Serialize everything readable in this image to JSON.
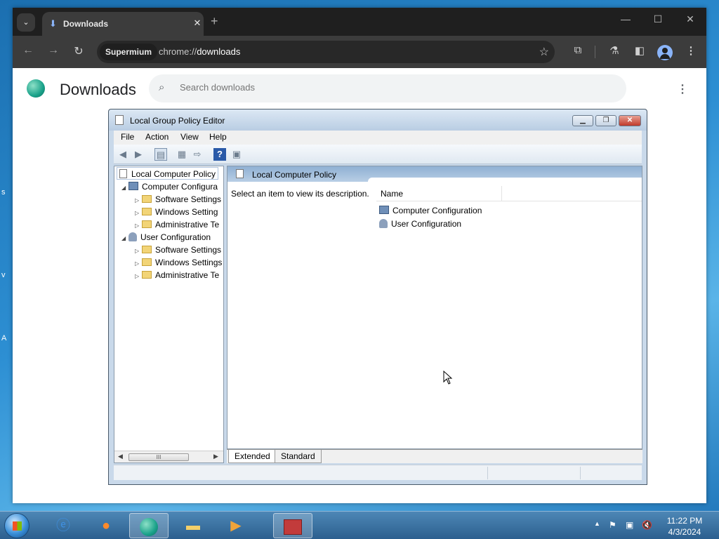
{
  "browser": {
    "tab_title": "Downloads",
    "tab_close": "✕",
    "new_tab": "+",
    "window_controls": {
      "minimize": "—",
      "maximize": "☐",
      "close": "✕"
    },
    "profile_chip": "Supermium",
    "url_scheme": "chrome://",
    "url_host": "downloads",
    "icons": {
      "back": "back-arrow-icon",
      "forward": "forward-arrow-icon",
      "reload": "reload-icon",
      "star": "bookmark-star-icon"
    }
  },
  "downloads_page": {
    "title": "Downloads",
    "search_placeholder": "Search downloads",
    "menu": "⋮"
  },
  "gpe": {
    "title": "Local Group Policy Editor",
    "menu": [
      "File",
      "Action",
      "View",
      "Help"
    ],
    "tree": {
      "root": "Local Computer Policy",
      "computer_config": "Computer Configura",
      "computer_children": [
        "Software Settings",
        "Windows Setting",
        "Administrative Te"
      ],
      "user_config": "User Configuration",
      "user_children": [
        "Software Settings",
        "Windows Settings",
        "Administrative Te"
      ]
    },
    "right_header": "Local Computer Policy",
    "description": "Select an item to view its description.",
    "column_name": "Name",
    "list": [
      "Computer Configuration",
      "User Configuration"
    ],
    "tabs": [
      "Extended",
      "Standard"
    ],
    "scroll_thumb": "III"
  },
  "taskbar": {
    "time": "11:22 PM",
    "date": "4/3/2024",
    "apps": [
      "internet-explorer",
      "firefox",
      "supermium",
      "file-explorer",
      "media-player",
      "group-policy-editor"
    ]
  }
}
